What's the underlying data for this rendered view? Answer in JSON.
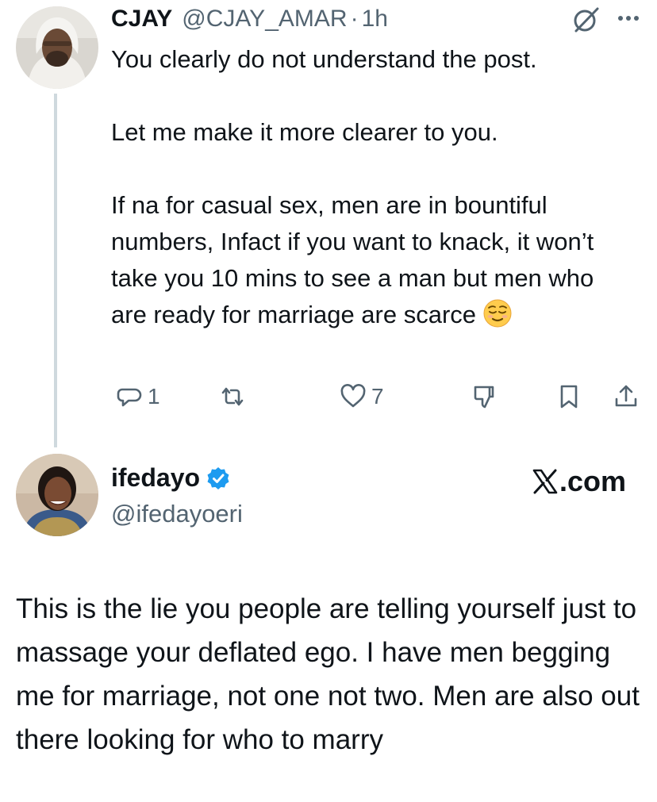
{
  "reply": {
    "display_name": "CJAY",
    "handle": "@CJAY_AMAR",
    "separator": "·",
    "time": "1h",
    "paragraphs": [
      "You clearly do not understand the post.",
      "Let me make it more clearer to you.",
      "If na for casual sex, men are in bountiful numbers, Infact if you want to knack, it won’t take you 10 mins to see a man but men who are ready for marriage are scarce"
    ],
    "emoji": "relieved-face",
    "actions": {
      "reply_count": "1",
      "like_count": "7"
    }
  },
  "quoted": {
    "display_name": "ifedayo",
    "handle": "@ifedayoeri",
    "watermark": ".com",
    "body": "This is the lie you people are telling yourself just to massage your deflated ego. I have men begging me for marriage, not one not two. Men are also out there looking for who to marry"
  },
  "colors": {
    "text": "#0f1419",
    "secondary": "#536471",
    "thread_line": "#cfd9de",
    "verified": "#1d9bf0"
  }
}
